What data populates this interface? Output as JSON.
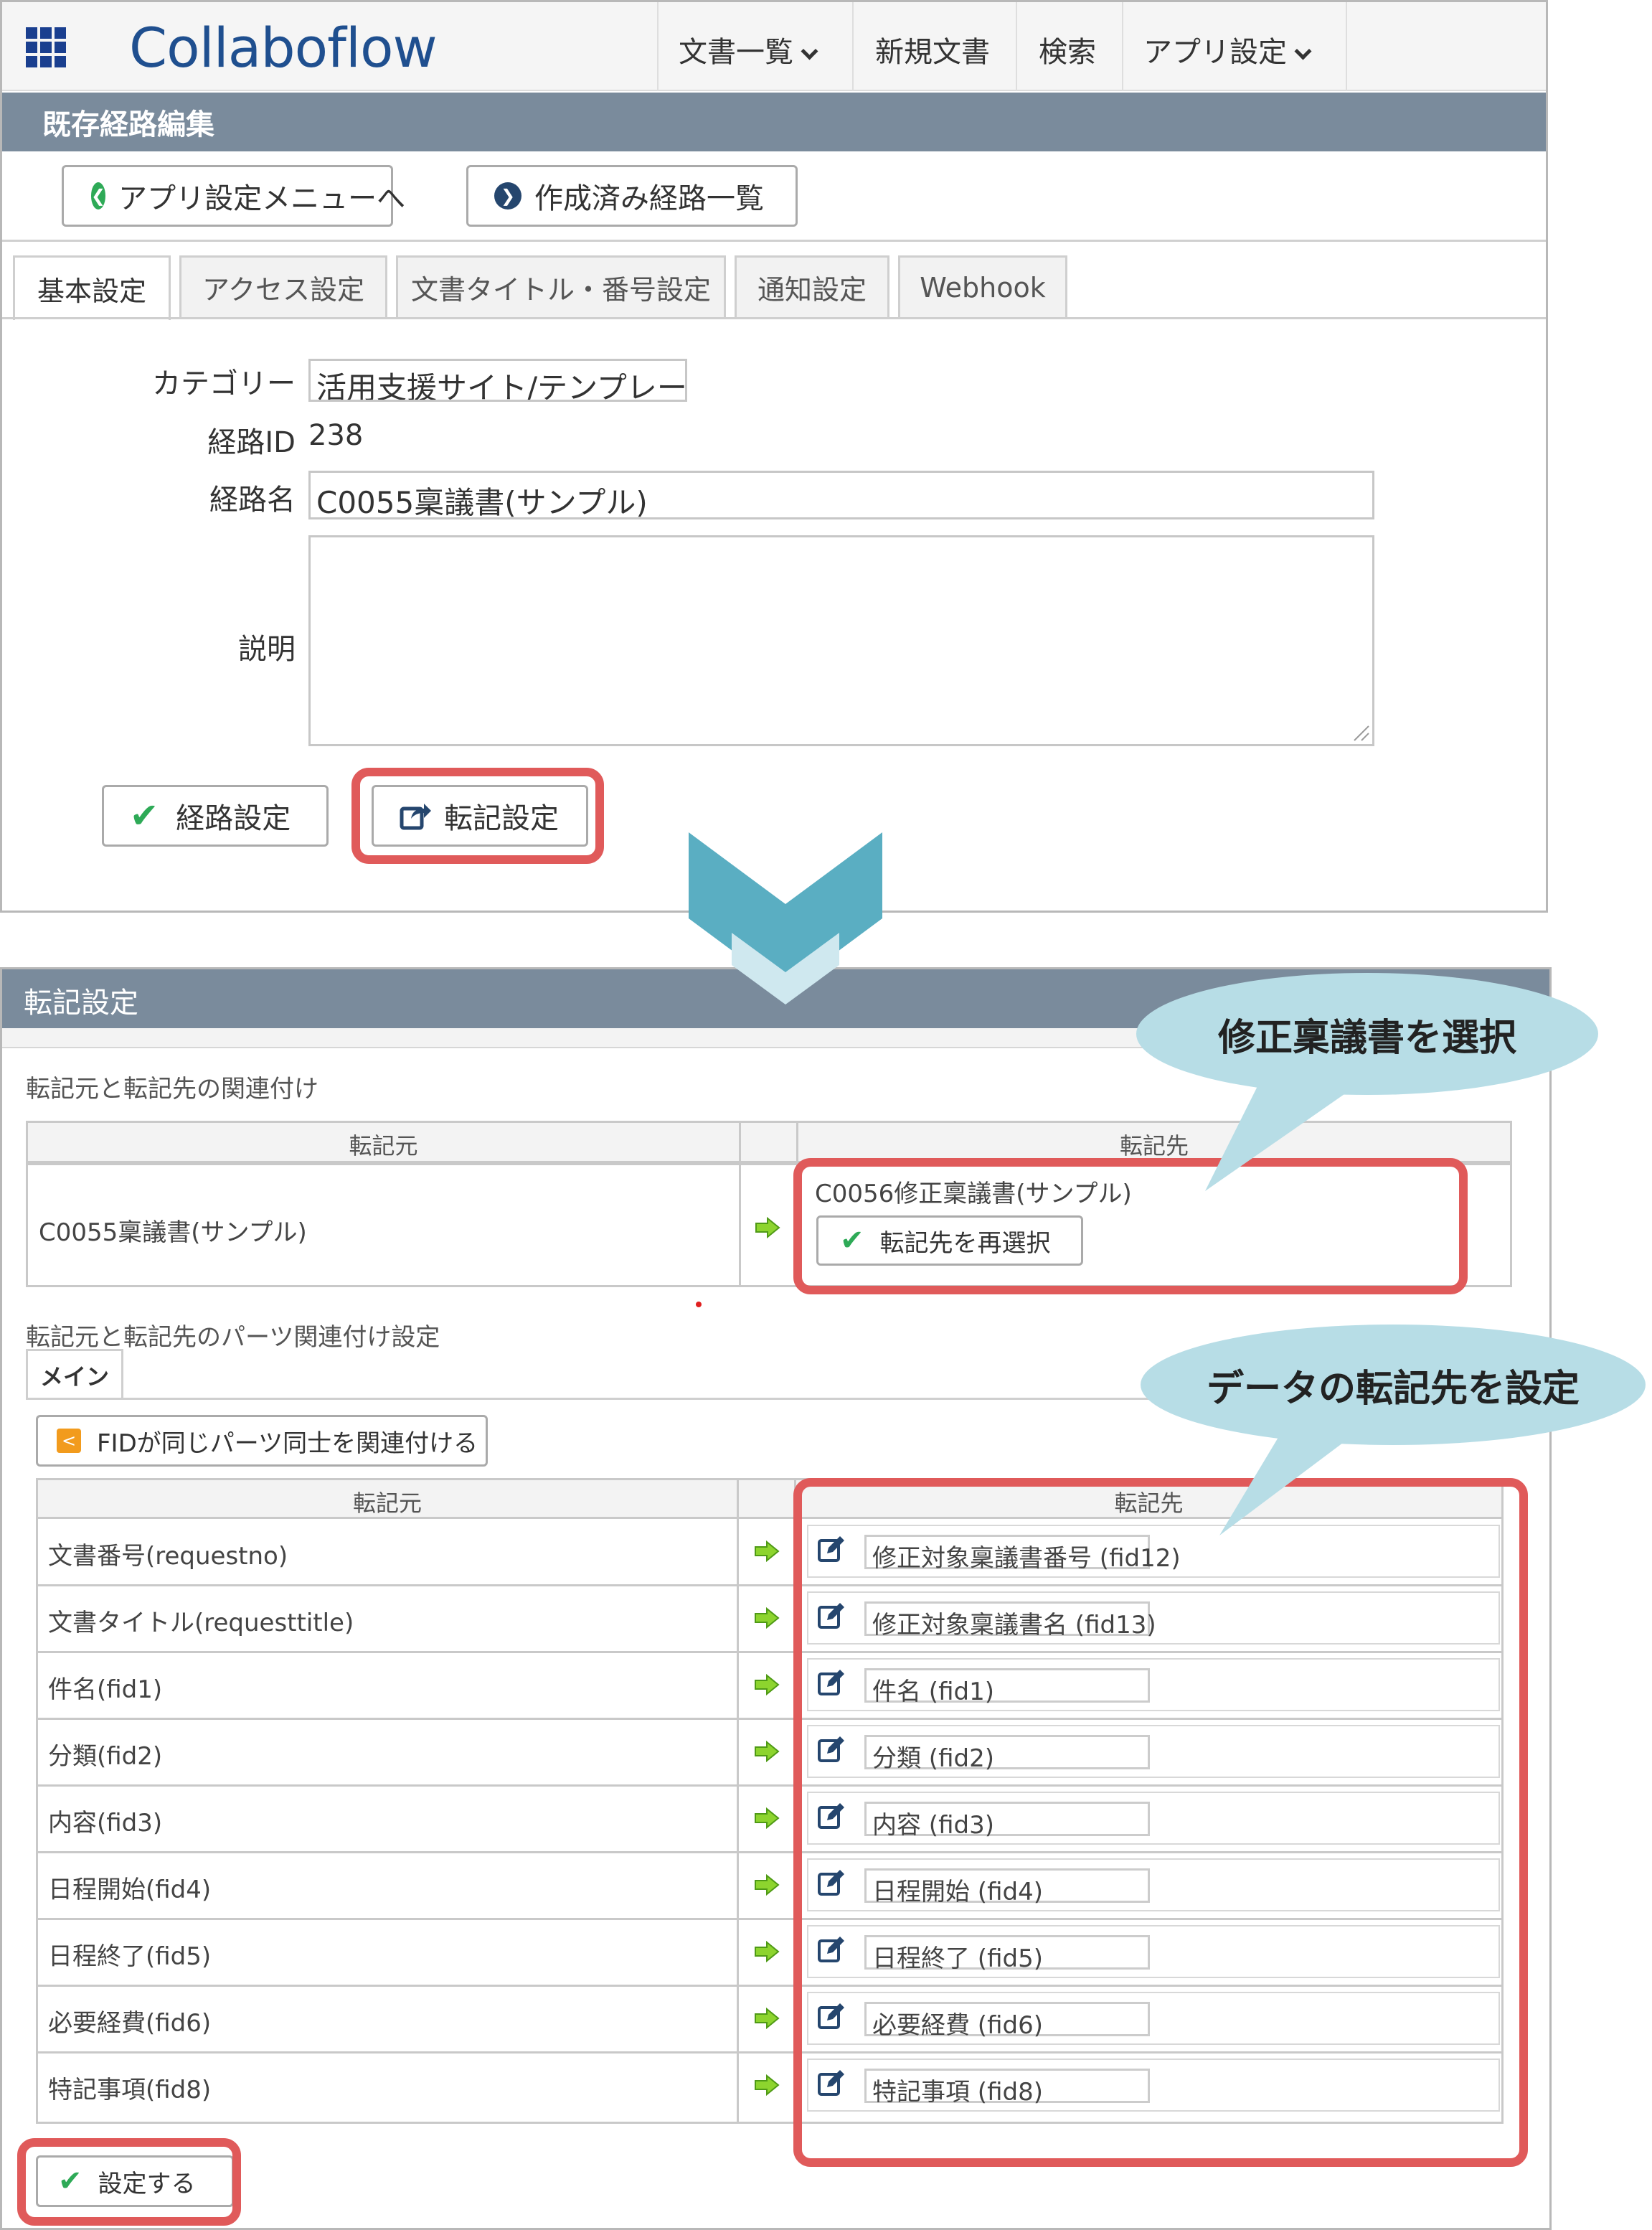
{
  "header": {
    "logo": "Collaboflow",
    "nav": {
      "documents": "文書一覧",
      "new_document": "新規文書",
      "search": "検索",
      "app_settings": "アプリ設定"
    }
  },
  "top_panel": {
    "title": "既存経路編集",
    "back_button": "アプリ設定メニューへ",
    "list_button": "作成済み経路一覧",
    "tabs": [
      "基本設定",
      "アクセス設定",
      "文書タイトル・番号設定",
      "通知設定",
      "Webhook"
    ],
    "form": {
      "category_label": "カテゴリー",
      "category_value": "活用支援サイト/テンプレート",
      "route_id_label": "経路ID",
      "route_id_value": "238",
      "route_name_label": "経路名",
      "route_name_value": "C0055稟議書(サンプル)",
      "description_label": "説明",
      "description_value": ""
    },
    "route_settings_button": "経路設定",
    "transcription_button": "転記設定"
  },
  "bottom_panel": {
    "title": "転記設定",
    "association_heading": "転記元と転記先の関連付け",
    "source_header": "転記元",
    "dest_header": "転記先",
    "source_route": "C0055稟議書(サンプル)",
    "dest_route": "C0056修正稟議書(サンプル)",
    "reselect_button": "転記先を再選択",
    "parts_heading": "転記元と転記先のパーツ関連付け設定",
    "main_tab": "メイン",
    "fid_button": "FIDが同じパーツ同士を関連付ける",
    "mapping_source_header": "転記元",
    "mapping_dest_header": "転記先",
    "rows": [
      {
        "source": "文書番号(requestno)",
        "dest": "修正対象稟議書番号 (fid12)"
      },
      {
        "source": "文書タイトル(requesttitle)",
        "dest": "修正対象稟議書名 (fid13)"
      },
      {
        "source": "件名(fid1)",
        "dest": "件名 (fid1)"
      },
      {
        "source": "分類(fid2)",
        "dest": "分類 (fid2)"
      },
      {
        "source": "内容(fid3)",
        "dest": "内容 (fid3)"
      },
      {
        "source": "日程開始(fid4)",
        "dest": "日程開始 (fid4)"
      },
      {
        "source": "日程終了(fid5)",
        "dest": "日程終了 (fid5)"
      },
      {
        "source": "必要経費(fid6)",
        "dest": "必要経費 (fid6)"
      },
      {
        "source": "特記事項(fid8)",
        "dest": "特記事項 (fid8)"
      }
    ],
    "save_button": "設定する"
  },
  "callouts": {
    "select_destination": "修正稟議書を選択",
    "set_destination": "データの転記先を設定"
  },
  "colors": {
    "title_bar": "#7a8b9c",
    "highlight": "#e05a5a",
    "callout": "#b7dde6",
    "arrow": "#5aaec2",
    "check_green": "#2eaa57"
  }
}
